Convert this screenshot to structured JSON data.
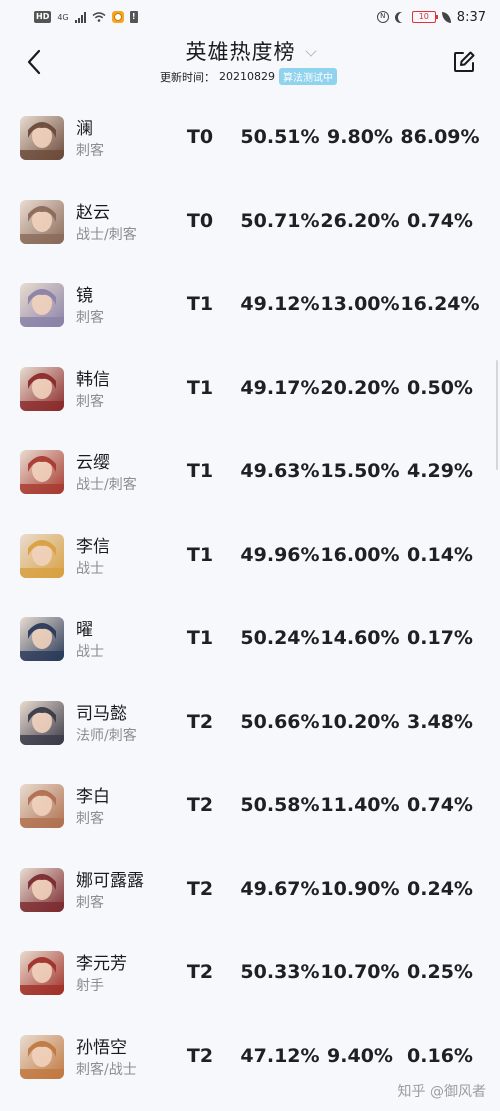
{
  "status_bar": {
    "hd": "HD",
    "network": "4G",
    "battery_level": "10",
    "time": "8:37"
  },
  "header": {
    "title": "英雄热度榜",
    "update_label": "更新时间：",
    "update_date": "20210829",
    "algo_badge": "算法测试中"
  },
  "heroes": [
    {
      "name": "澜",
      "role": "刺客",
      "tier": "T0",
      "win_rate": "50.51%",
      "pick_rate": "9.80%",
      "ban_rate": "86.09%",
      "color": "#6b4a3a"
    },
    {
      "name": "赵云",
      "role": "战士/刺客",
      "tier": "T0",
      "win_rate": "50.71%",
      "pick_rate": "26.20%",
      "ban_rate": "0.74%",
      "color": "#8a6a5a"
    },
    {
      "name": "镜",
      "role": "刺客",
      "tier": "T1",
      "win_rate": "49.12%",
      "pick_rate": "13.00%",
      "ban_rate": "16.24%",
      "color": "#8a82a8"
    },
    {
      "name": "韩信",
      "role": "刺客",
      "tier": "T1",
      "win_rate": "49.17%",
      "pick_rate": "20.20%",
      "ban_rate": "0.50%",
      "color": "#8a2a2a"
    },
    {
      "name": "云缨",
      "role": "战士/刺客",
      "tier": "T1",
      "win_rate": "49.63%",
      "pick_rate": "15.50%",
      "ban_rate": "4.29%",
      "color": "#a83a30"
    },
    {
      "name": "李信",
      "role": "战士",
      "tier": "T1",
      "win_rate": "49.96%",
      "pick_rate": "16.00%",
      "ban_rate": "0.14%",
      "color": "#d8a040"
    },
    {
      "name": "曜",
      "role": "战士",
      "tier": "T1",
      "win_rate": "50.24%",
      "pick_rate": "14.60%",
      "ban_rate": "0.17%",
      "color": "#2a3a5a"
    },
    {
      "name": "司马懿",
      "role": "法师/刺客",
      "tier": "T2",
      "win_rate": "50.66%",
      "pick_rate": "10.20%",
      "ban_rate": "3.48%",
      "color": "#3a3a48"
    },
    {
      "name": "李白",
      "role": "刺客",
      "tier": "T2",
      "win_rate": "50.58%",
      "pick_rate": "11.40%",
      "ban_rate": "0.74%",
      "color": "#b07050"
    },
    {
      "name": "娜可露露",
      "role": "刺客",
      "tier": "T2",
      "win_rate": "49.67%",
      "pick_rate": "10.90%",
      "ban_rate": "0.24%",
      "color": "#7a2a30"
    },
    {
      "name": "李元芳",
      "role": "射手",
      "tier": "T2",
      "win_rate": "50.33%",
      "pick_rate": "10.70%",
      "ban_rate": "0.25%",
      "color": "#a03028"
    },
    {
      "name": "孙悟空",
      "role": "刺客/战士",
      "tier": "T2",
      "win_rate": "47.12%",
      "pick_rate": "9.40%",
      "ban_rate": "0.16%",
      "color": "#c07840"
    }
  ],
  "watermark": "知乎 @御风者"
}
